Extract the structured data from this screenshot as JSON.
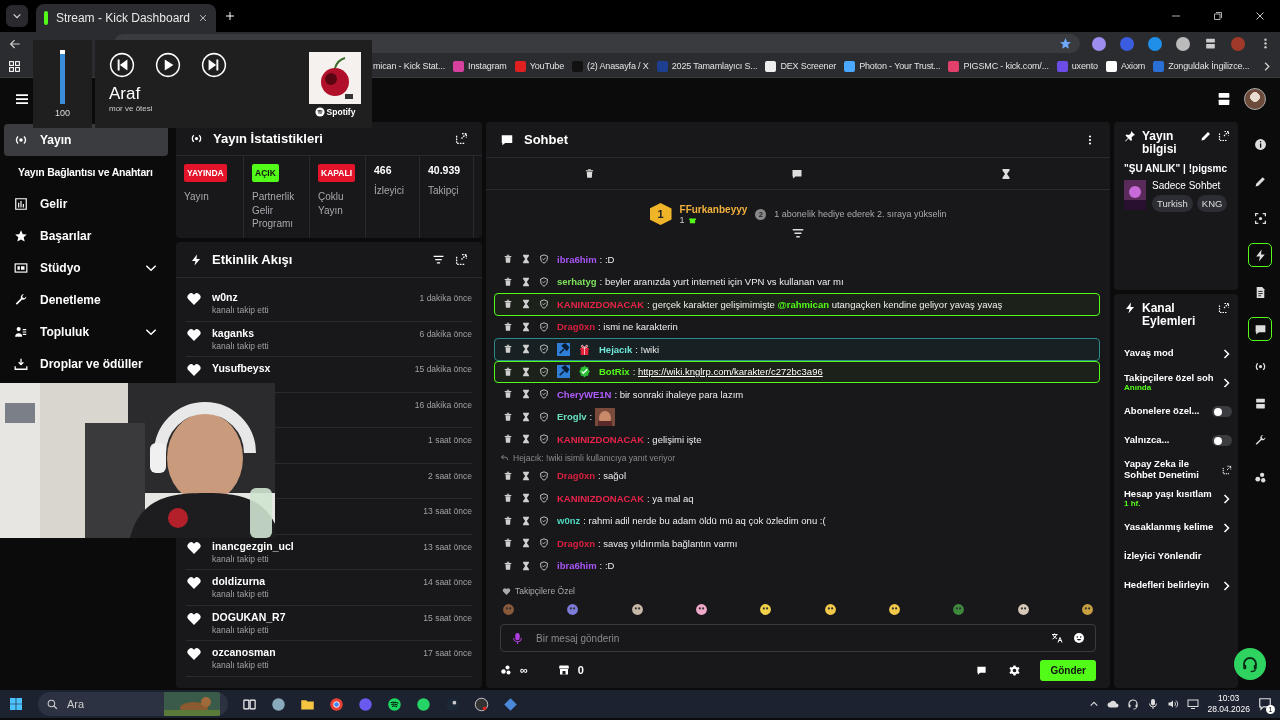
{
  "browser": {
    "tabs": [
      {
        "title": "Stream - Kick Dashboard",
        "selected": true
      }
    ],
    "bookmarks": [
      "mican - Kick Stat...",
      "Instagram",
      "YouTube",
      "(2) Anasayfa / X",
      "2025 Tamamlayıcı S...",
      "DEX Screener",
      "Photon - Your Trust...",
      "PIGSMC - kick.com/...",
      "uxento",
      "Axiom",
      "Zonguldak İngilizce..."
    ]
  },
  "media": {
    "volume": {
      "level": 1,
      "reading": "100"
    },
    "title": "Araf",
    "artist": "mor ve ötesi",
    "service": "Spotify",
    "playing": false
  },
  "sidebar": {
    "items": [
      {
        "label": "Yayın",
        "kind": "main",
        "selected": true
      },
      {
        "label": "Yayın Bağlantısı ve Anahtarı",
        "kind": "sub",
        "selected": false
      },
      {
        "label": "Gelir",
        "kind": "main",
        "selected": false
      },
      {
        "label": "Başarılar",
        "kind": "main",
        "selected": false
      },
      {
        "label": "Stüdyo",
        "kind": "group",
        "selected": false,
        "expanded": false
      },
      {
        "label": "Denetleme",
        "kind": "main",
        "selected": false
      },
      {
        "label": "Topluluk",
        "kind": "group",
        "selected": false,
        "expanded": false
      },
      {
        "label": "Droplar ve ödüller",
        "kind": "main",
        "selected": false
      }
    ]
  },
  "stats": {
    "title": "Yayın İstatistikleri",
    "items": [
      {
        "kind": "badge",
        "badge": "YAYINDA",
        "color": "#e3142a",
        "label": "Yayın"
      },
      {
        "kind": "badge",
        "badge": "AÇIK",
        "color": "#53fc18",
        "label": "Partnerlik Gelir Programı"
      },
      {
        "kind": "badge",
        "badge": "KAPALI",
        "color": "#e3142a",
        "label": "Çoklu Yayın"
      },
      {
        "kind": "value",
        "value": "466",
        "label": "İzleyici"
      },
      {
        "kind": "value",
        "value": "40.939",
        "label": "Takipçi"
      }
    ]
  },
  "activity": {
    "title": "Etkinlik Akışı",
    "rows": [
      {
        "user": "w0nz",
        "action": "kanalı takip etti",
        "time": "1 dakika önce"
      },
      {
        "user": "kaganks",
        "action": "kanalı takip etti",
        "time": "6 dakika önce"
      },
      {
        "user": "Yusufbeysx",
        "time": "15 dakika önce"
      },
      {
        "time": "16 dakika önce"
      },
      {
        "time": "1 saat önce"
      },
      {
        "time": "2 saat önce"
      },
      {
        "time": "13 saat önce"
      },
      {
        "user": "inancgezgin_ucl",
        "action": "kanalı takip etti",
        "time": "13 saat önce"
      },
      {
        "user": "doldizurna",
        "action": "kanalı takip etti",
        "time": "14 saat önce"
      },
      {
        "user": "DOGUKAN_R7",
        "action": "kanalı takip etti",
        "time": "15 saat önce"
      },
      {
        "user": "ozcanosman",
        "action": "kanalı takip etti",
        "time": "17 saat önce"
      }
    ]
  },
  "chat": {
    "title": "Sohbet",
    "leader": {
      "rank": "1",
      "user": "FFurkanbeyyy",
      "gifts": "1",
      "next_rank": "2",
      "hint": "1 abonelik hediye ederek 2. sıraya yükselin"
    },
    "messages": [
      {
        "user": "ibra6him",
        "color": "#a855f7",
        "kind": "plain",
        "parts": [
          {
            "kind": "text",
            "text": ": :D"
          }
        ]
      },
      {
        "user": "serhatyg",
        "color": "#7ee05a",
        "kind": "plain",
        "parts": [
          {
            "kind": "text",
            "text": ": beyler aranızda yurt interneti için VPN vs kullanan var mı"
          }
        ]
      },
      {
        "user": "KANINIZDONACAK",
        "color": "#e8234a",
        "kind": "mention",
        "parts": [
          {
            "kind": "text",
            "text": ": gerçek karakter gelişimimişte "
          },
          {
            "kind": "mention",
            "text": "@rahmican"
          },
          {
            "kind": "text",
            "text": " utangaçken kendine geliyor yavaş yavaş"
          }
        ]
      },
      {
        "user": "Drag0xn",
        "color": "#d9203f",
        "kind": "plain",
        "parts": [
          {
            "kind": "text",
            "text": ": ismi ne karakterin"
          }
        ]
      },
      {
        "user": "Hejacık",
        "color": "#6ee7d8",
        "kind": "moderator",
        "badges": [
          {
            "kind": "moderator"
          },
          {
            "kind": "gift"
          }
        ],
        "parts": [
          {
            "kind": "text",
            "text": ": !wiki"
          }
        ]
      },
      {
        "user": "BotRix",
        "color": "#53fc18",
        "kind": "bot",
        "badges": [
          {
            "kind": "moderator"
          },
          {
            "kind": "verified"
          }
        ],
        "parts": [
          {
            "kind": "text",
            "text": ": "
          },
          {
            "kind": "link",
            "text": "https://wiki.knglrp.com/karakter/c272bc3a96"
          }
        ]
      },
      {
        "user": "CheryWE1N",
        "color": "#b15cff",
        "kind": "plain",
        "parts": [
          {
            "kind": "text",
            "text": ": bir sonraki ihaleye para lazım"
          }
        ]
      },
      {
        "user": "Eroglv",
        "color": "#67e0c0",
        "kind": "plain",
        "parts": [
          {
            "kind": "text",
            "text": ":"
          },
          {
            "kind": "picture"
          }
        ]
      },
      {
        "user": "KANINIZDONACAK",
        "color": "#e8234a",
        "kind": "plain",
        "parts": [
          {
            "kind": "text",
            "text": ": gelişimi işte"
          }
        ]
      },
      {
        "user": "Drag0xn",
        "color": "#d9203f",
        "kind": "plain",
        "reply": "Hejacık: !wiki isimli kullanıcıya yanıt veriyor",
        "parts": [
          {
            "kind": "text",
            "text": ": sağol"
          }
        ]
      },
      {
        "user": "KANINIZDONACAK",
        "color": "#e8234a",
        "kind": "plain",
        "parts": [
          {
            "kind": "text",
            "text": ": ya mal aq"
          }
        ]
      },
      {
        "user": "w0nz",
        "color": "#4fd6bf",
        "kind": "plain",
        "parts": [
          {
            "kind": "text",
            "text": ": rahmi adil nerde bu adam öldü mü aq çok özledim onu :("
          }
        ]
      },
      {
        "user": "Drag0xn",
        "color": "#d9203f",
        "kind": "plain",
        "parts": [
          {
            "kind": "text",
            "text": ": savaş yıldırımla bağlantın varmı"
          }
        ]
      },
      {
        "user": "ibra6him",
        "color": "#a855f7",
        "kind": "plain",
        "parts": [
          {
            "kind": "text",
            "text": ": :D"
          }
        ]
      }
    ],
    "emote_section": "Takipçilere Özel",
    "input": {
      "placeholder": "Bir mesaj gönderin"
    },
    "points": "∞",
    "store_count": "0",
    "send": "Gönder"
  },
  "stream_info": {
    "title": "Yayın bilgisi",
    "stream_title": "\"ŞU ANLIK\" | !pigsmc",
    "category": "Sadece Sohbet",
    "tags": [
      "Turkish",
      "KNG"
    ]
  },
  "channel_actions": {
    "title": "Kanal Eylemleri",
    "items": [
      {
        "kind": "chevron",
        "label": "Yavaş mod"
      },
      {
        "kind": "chevron",
        "label": "Takipçilere özel soh",
        "value": "Anında"
      },
      {
        "kind": "toggle",
        "label": "Abonelere özel...",
        "on": false
      },
      {
        "kind": "toggle",
        "label": "Yalnızca...",
        "on": false
      },
      {
        "kind": "external",
        "label": "Yapay Zeka ile Sohbet Denetimi"
      },
      {
        "kind": "chevron",
        "label": "Hesap yaşı kısıtlam",
        "value": "1 hf."
      },
      {
        "kind": "chevron",
        "label": "Yasaklanmış kelime"
      },
      {
        "kind": "plain",
        "label": "İzleyici Yönlendir"
      },
      {
        "kind": "chevron",
        "label": "Hedefleri belirleyin"
      }
    ]
  },
  "dock": [
    {
      "active": false
    },
    {
      "active": false
    },
    {
      "active": false
    },
    {
      "active": true
    },
    {
      "active": false
    },
    {
      "active": true
    },
    {
      "active": false
    },
    {
      "active": false
    },
    {
      "active": false
    },
    {
      "active": false
    }
  ],
  "taskbar": {
    "search": "Ara",
    "time": "10:03",
    "date": "28.04.2026",
    "notifications": "1"
  }
}
